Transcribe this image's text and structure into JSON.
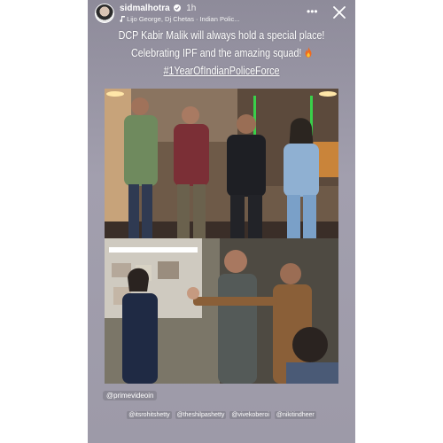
{
  "header": {
    "username": "sidmalhotra",
    "time": "1h",
    "music": [
      "Lijo George, Dj Chetas",
      "Indian Polic..."
    ]
  },
  "caption": {
    "line1": "DCP Kabir Malik will always hold a special place!",
    "line2": "Celebrating IPF and the amazing squad!",
    "line3": "#1YearOfIndianPoliceForce"
  },
  "mention_main": "@primevideoin",
  "mentions": [
    "@itsrohitshetty",
    "@theshilpashetty",
    "@vivekoberoi",
    "@nikitindheer"
  ],
  "colors": {
    "story_bg": "#9c99a8",
    "text": "#ffffff"
  },
  "icons": [
    "verified-icon",
    "more-options-icon",
    "close-icon",
    "fire-emoji-icon"
  ]
}
